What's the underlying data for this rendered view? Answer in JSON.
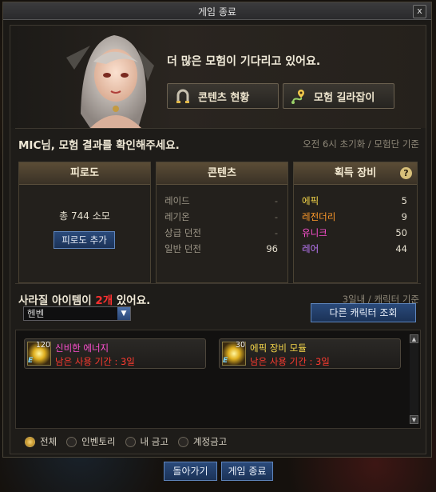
{
  "window": {
    "title": "게임 종료",
    "close": "x"
  },
  "hero": {
    "message": "더 많은 모험이 기다리고 있어요.",
    "content_status_button": "콘텐츠 현황",
    "adventure_guide_button": "모험 길라잡이"
  },
  "result": {
    "heading": "MIC님, 모험 결과를 확인해주세요.",
    "note": "오전 6시 초기화 / 모험단 기준"
  },
  "fatigue": {
    "title": "피로도",
    "value": "총 744 소모",
    "add_button": "피로도 추가"
  },
  "contents": {
    "title": "콘텐츠",
    "rows": [
      {
        "label": "레이드",
        "value": "-"
      },
      {
        "label": "레기온",
        "value": "-"
      },
      {
        "label": "상급 던전",
        "value": "-"
      },
      {
        "label": "일반 던전",
        "value": "96"
      }
    ]
  },
  "gear": {
    "title": "획득 장비",
    "help": "?",
    "rows": [
      {
        "label": "에픽",
        "value": "5",
        "color": "#f7d84a"
      },
      {
        "label": "레전더리",
        "value": "9",
        "color": "#ff9a2a"
      },
      {
        "label": "유니크",
        "value": "50",
        "color": "#ff4fd2"
      },
      {
        "label": "레어",
        "value": "44",
        "color": "#c07bff"
      }
    ]
  },
  "vanish": {
    "prefix": "사라질 아이템이 ",
    "count": "2개",
    "suffix": " 있어요.",
    "note": "3일내 / 캐릭터 기준",
    "character_select": "헨벤",
    "other_char_button": "다른 캐릭터 조회"
  },
  "items": [
    {
      "count": "120",
      "name": "신비한 에너지",
      "remaining": "남은 사용 기간 : 3일",
      "name_color": "#ff4fd2"
    },
    {
      "count": "30",
      "name": "에픽 장비 모듈",
      "remaining": "남은 사용 기간 : 3일",
      "name_color": "#f7d84a"
    }
  ],
  "filters": [
    "전체",
    "인벤토리",
    "내 금고",
    "계정금고"
  ],
  "footer": {
    "back_button": "돌아가기",
    "exit_button": "게임 종료"
  }
}
